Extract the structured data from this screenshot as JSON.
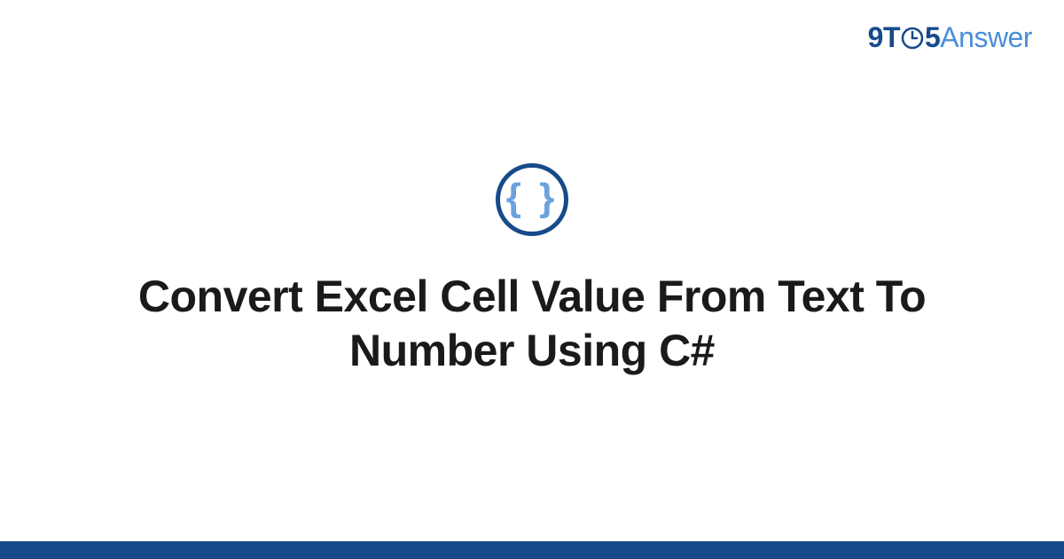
{
  "brand": {
    "part_nine": "9",
    "part_t": "T",
    "part_five": "5",
    "part_answer": "Answer"
  },
  "icon": {
    "braces": "{ }"
  },
  "title": "Convert Excel Cell Value From Text To Number Using C#",
  "colors": {
    "primary": "#164a8a",
    "accent": "#4a8fd8",
    "brace": "#6aa3dc"
  }
}
